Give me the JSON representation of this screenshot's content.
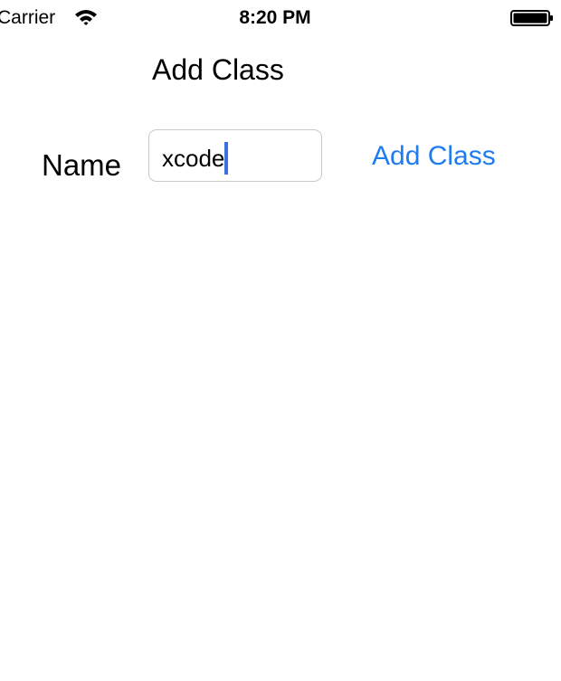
{
  "status_bar": {
    "carrier": "Carrier",
    "time": "8:20 PM",
    "wifi_icon": "wifi-icon",
    "battery_icon": "battery-icon",
    "battery_level": 1.0
  },
  "nav": {
    "title": "Add Class"
  },
  "form": {
    "name_label": "Name",
    "name_value": "xcode",
    "add_button_label": "Add Class"
  },
  "colors": {
    "accent": "#1f7cf0",
    "caret": "#3b6fe6"
  }
}
